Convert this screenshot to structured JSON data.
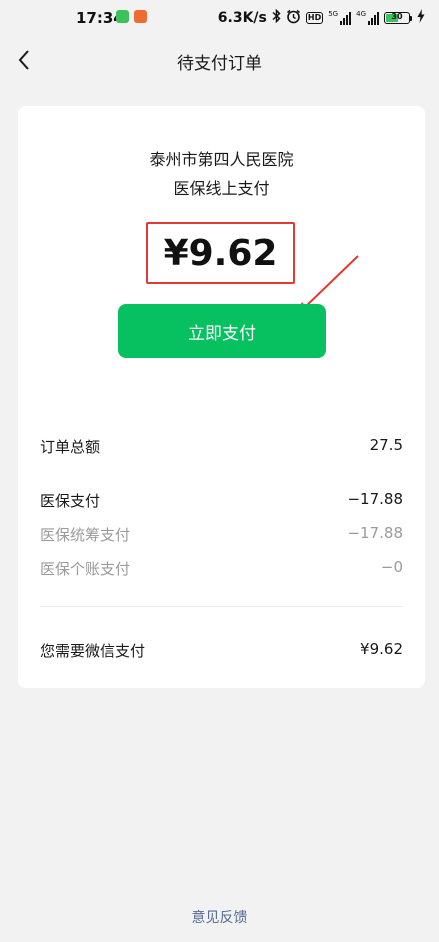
{
  "status_bar": {
    "time": "17:34",
    "net_speed": "6.3K/s",
    "signal1_tag": "5G",
    "signal2_tag": "4G",
    "battery_level": "30"
  },
  "nav": {
    "title": "待支付订单",
    "back_icon": "chevron-left-icon"
  },
  "order": {
    "hospital": "泰州市第四人民医院",
    "pay_type": "医保线上支付",
    "amount": "¥9.62",
    "pay_button": "立即支付"
  },
  "details": [
    {
      "label": "订单总额",
      "value": "27.5"
    },
    {
      "label": "医保支付",
      "value": "−17.88"
    },
    {
      "label": "医保统筹支付",
      "value": "−17.88"
    },
    {
      "label": "医保个账支付",
      "value": "−0"
    }
  ],
  "summary": {
    "label": "您需要微信支付",
    "value": "¥9.62"
  },
  "footer": {
    "feedback": "意见反馈"
  },
  "colors": {
    "accent": "#07c160",
    "highlight_box": "#e53935",
    "link": "#576b95"
  }
}
